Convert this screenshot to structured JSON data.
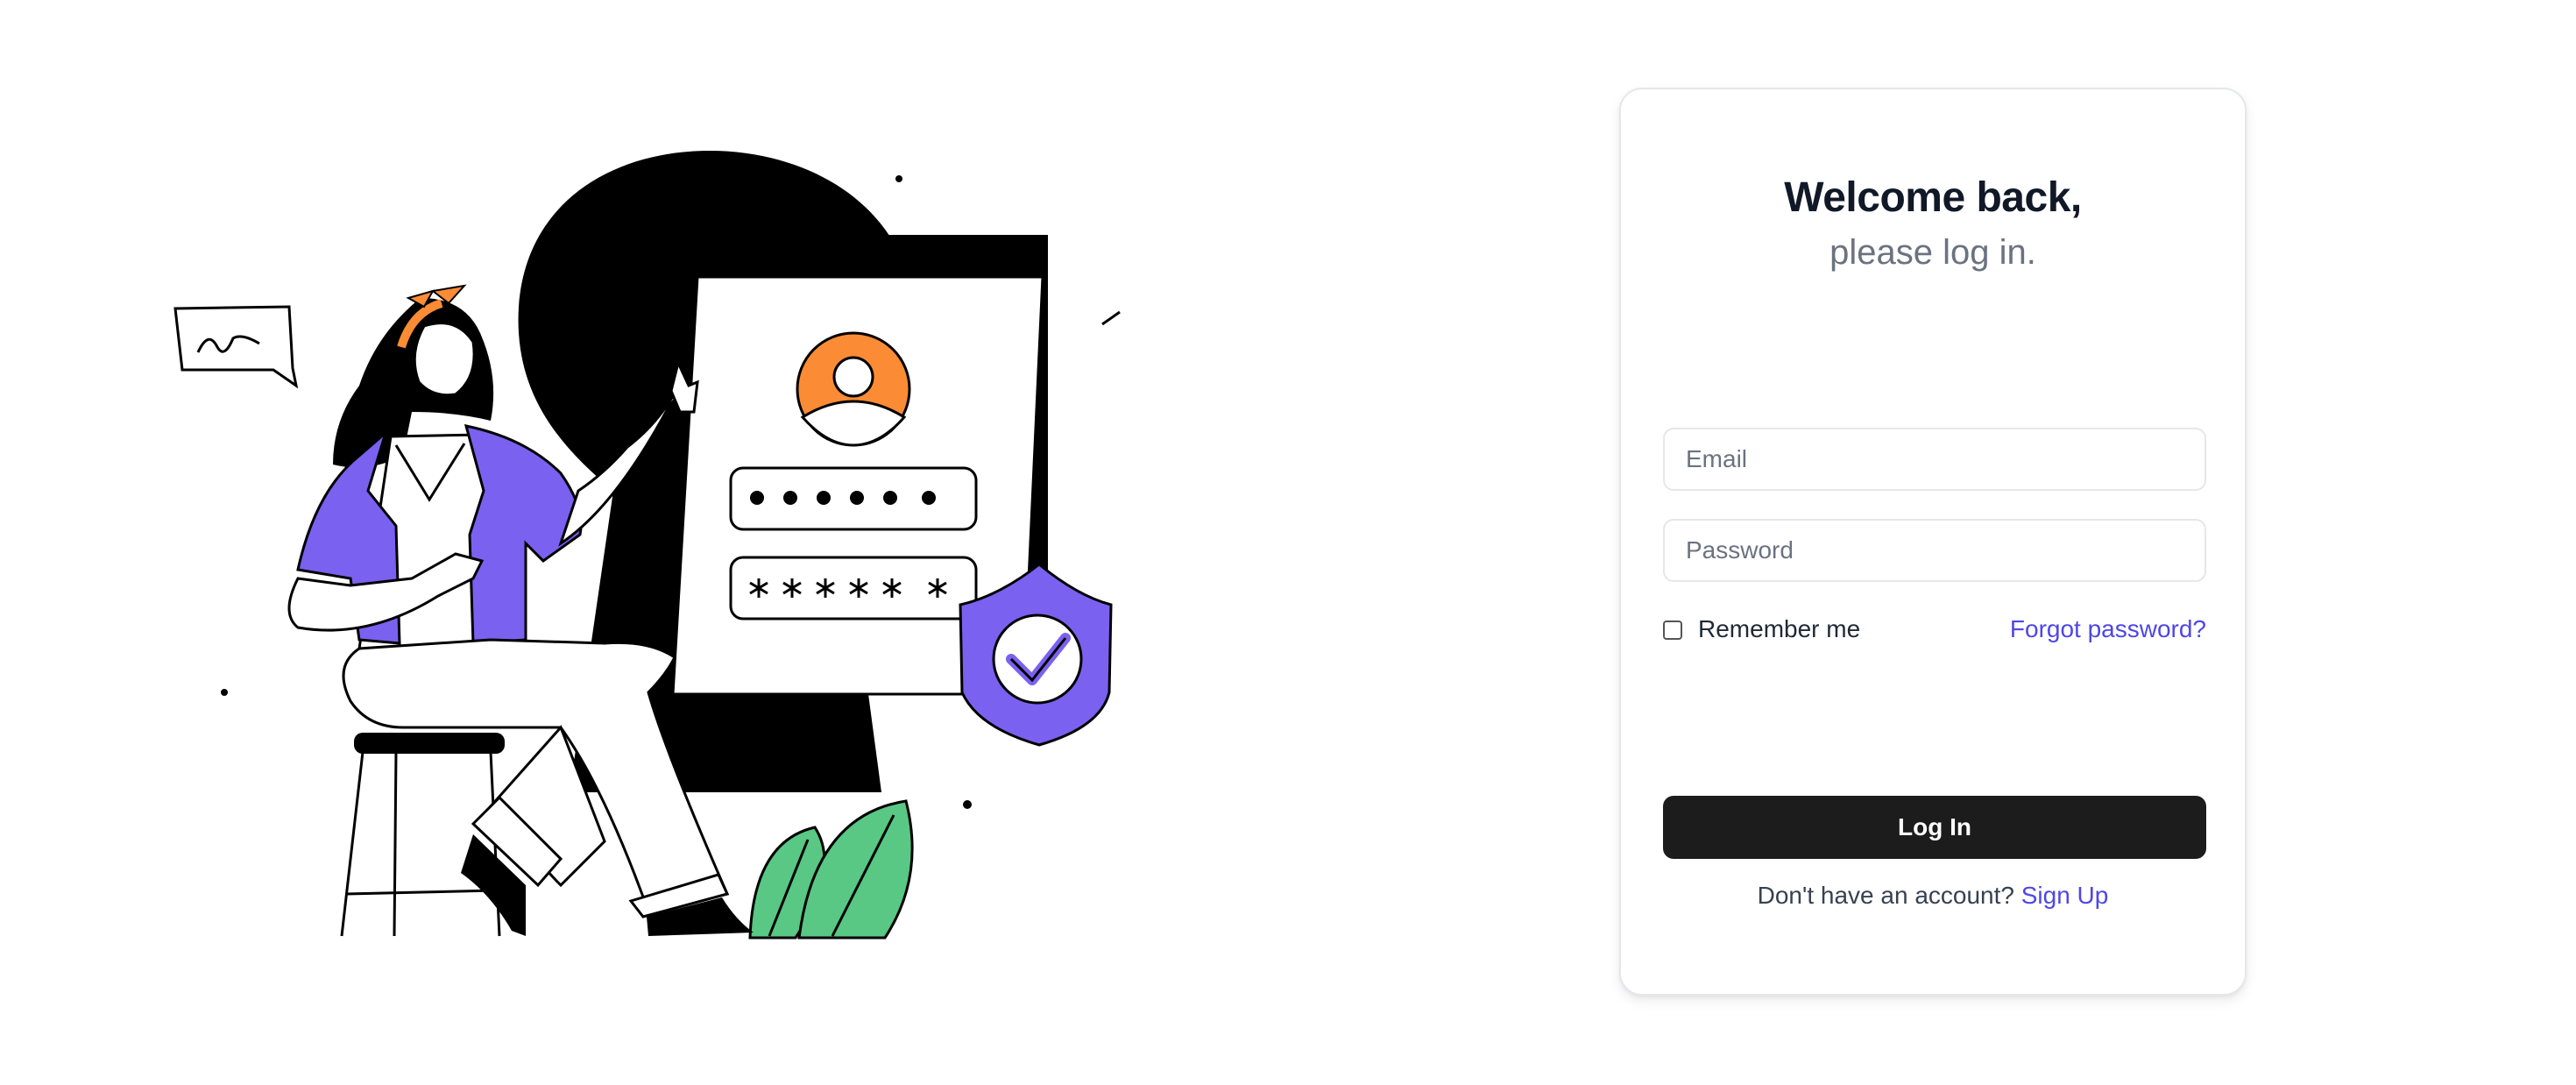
{
  "login": {
    "title": "Welcome back,",
    "subtitle": "please log in.",
    "email_placeholder": "Email",
    "password_placeholder": "Password",
    "remember_label": "Remember me",
    "forgot_label": "Forgot password?",
    "submit_label": "Log In",
    "signup_prompt": "Don't have an account?",
    "signup_label": "Sign Up"
  },
  "colors": {
    "accent": "#4f46e5",
    "button": "#1c1c1c",
    "illustration_orange": "#fb8c35",
    "illustration_purple": "#7b61f0",
    "illustration_green": "#58c884"
  },
  "illustration": {
    "name": "login-security-illustration",
    "password_dots": "● ● ● ● ● ●",
    "password_stars": "✱ ✱ ✱ ✱ ✱ ✱"
  }
}
